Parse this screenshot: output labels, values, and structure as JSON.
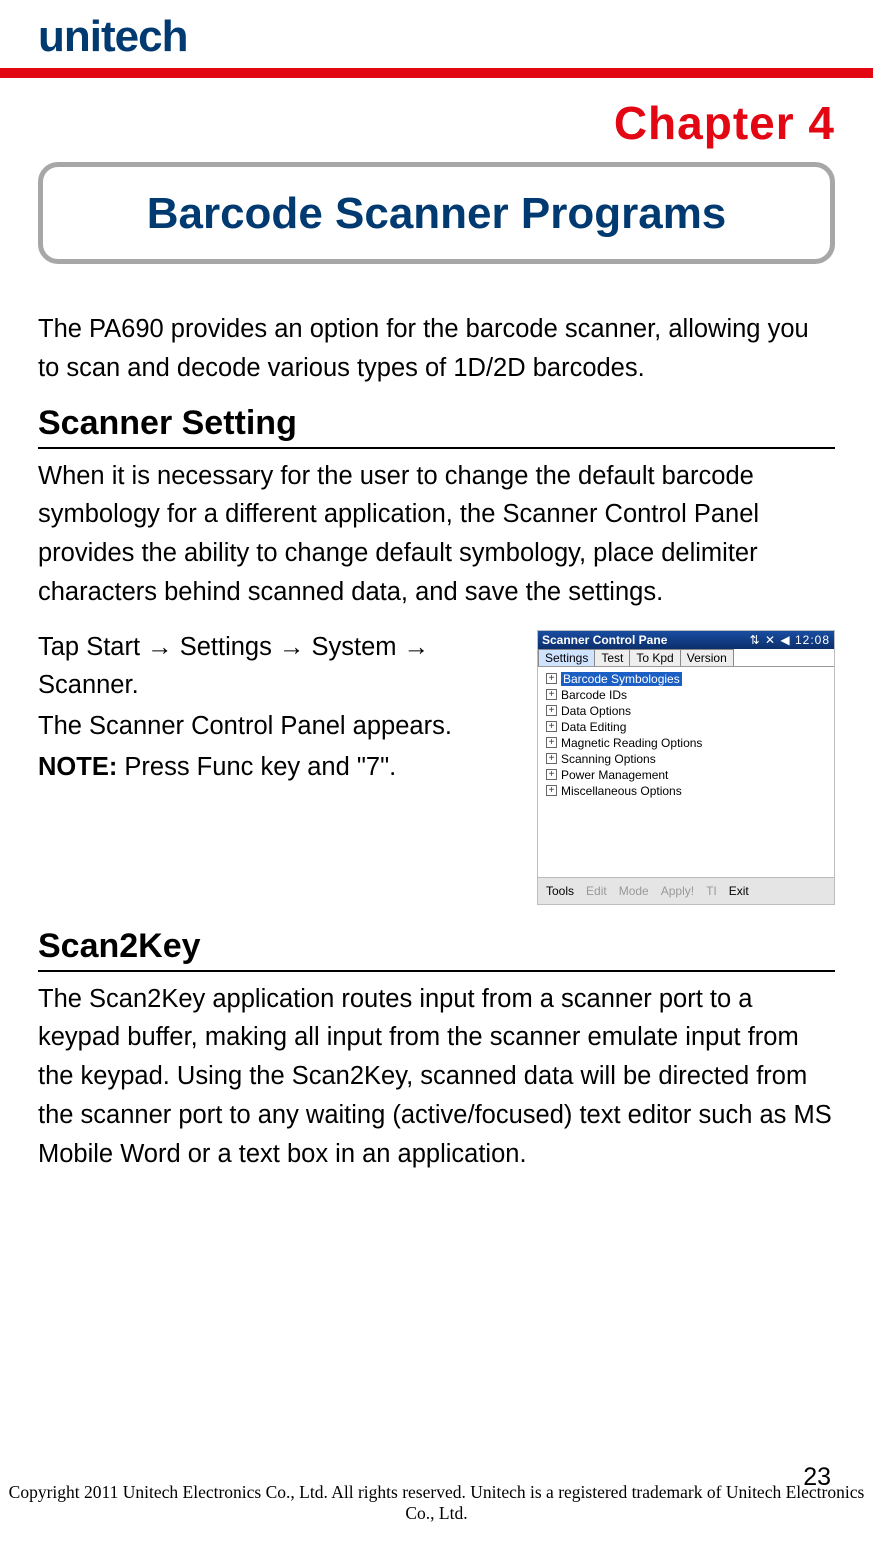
{
  "logo_text": "unitech",
  "chapter_label": "Chapter  4",
  "chapter_title": "Barcode Scanner Programs",
  "intro": "The PA690 provides an option for the barcode scanner, allowing you to scan and decode various types of 1D/2D barcodes.",
  "section1": {
    "heading": "Scanner Setting",
    "p1": "When it is necessary for the user to change the default barcode symbology for a different application, the Scanner Control Panel provides the ability to change default symbology, place delimiter characters behind scanned data, and save the settings.",
    "p2": "Tap Start → Settings → System → Scanner.",
    "p3": "The Scanner Control Panel appears.",
    "note_label": "NOTE:",
    "note_text": " Press Func key and \"7\"."
  },
  "screenshot": {
    "title": "Scanner Control Pane",
    "clock": "12:08",
    "tabs": [
      "Settings",
      "Test",
      "To Kpd",
      "Version"
    ],
    "tree": [
      "Barcode Symbologies",
      "Barcode IDs",
      "Data Options",
      "Data Editing",
      "Magnetic Reading Options",
      "Scanning Options",
      "Power Management",
      "Miscellaneous Options"
    ],
    "bottom": {
      "tools": "Tools",
      "edit": "Edit",
      "mode": "Mode",
      "apply": "Apply!",
      "ti": "TI",
      "exit": "Exit"
    }
  },
  "section2": {
    "heading": "Scan2Key",
    "p1": "The Scan2Key application routes input from a scanner port to a keypad buffer, making all input from the scanner emulate input from the keypad. Using the Scan2Key, scanned data will be directed from the scanner port to any waiting (active/focused) text editor such as MS Mobile Word or a text box in an application."
  },
  "page_number": "23",
  "footer": "Copyright 2011 Unitech Electronics Co., Ltd. All rights reserved. Unitech is a registered trademark of Unitech Electronics Co., Ltd."
}
